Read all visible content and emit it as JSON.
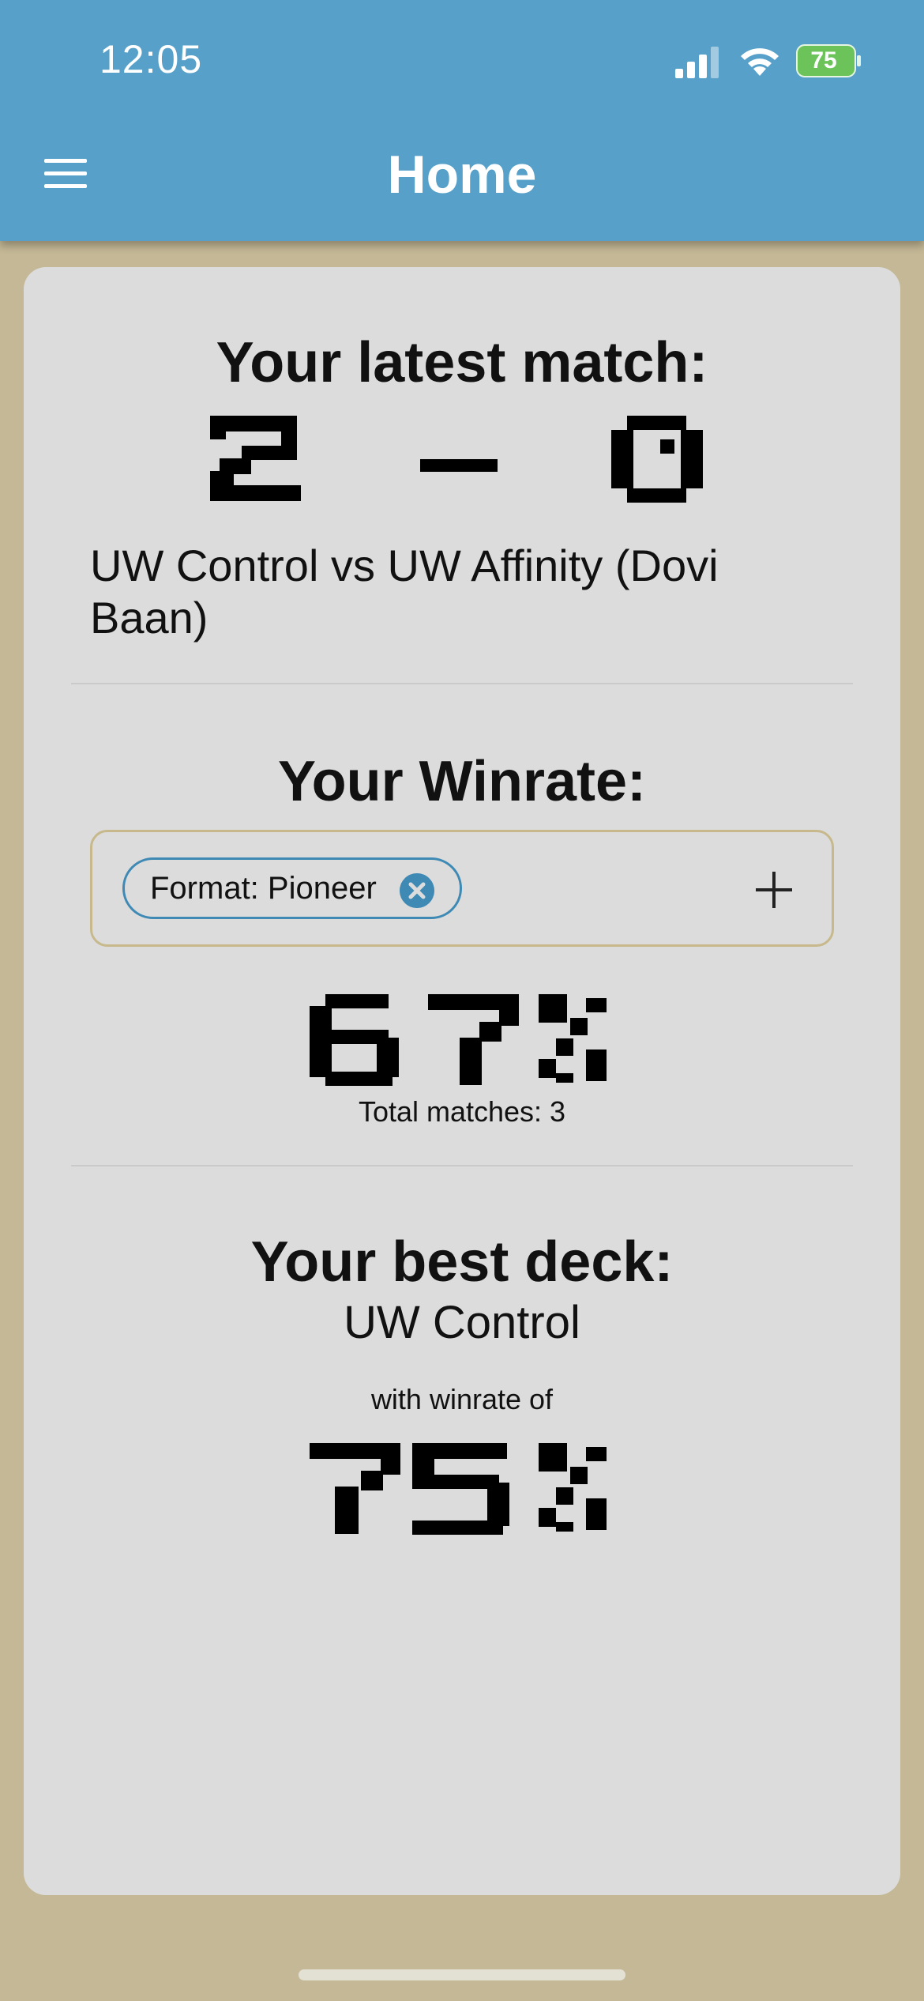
{
  "status_bar": {
    "time": "12:05",
    "battery_percent": "75",
    "icons": [
      "signal-icon",
      "wifi-icon",
      "battery-charging-icon"
    ]
  },
  "header": {
    "title": "Home",
    "menu_icon": "hamburger-menu-icon"
  },
  "latest_match": {
    "heading": "Your latest match:",
    "score_left": "2",
    "score_separator": "–",
    "score_right": "0",
    "description": "UW Control vs UW Affinity (Dovi Baan)"
  },
  "winrate": {
    "heading": "Your Winrate:",
    "filter_chip": "Format: Pioneer",
    "chip_close_icon": "close-circle-icon",
    "add_filter_icon": "plus-icon",
    "value": "67%",
    "total_matches": "Total matches: 3"
  },
  "best_deck": {
    "heading": "Your best deck:",
    "deck_name": "UW Control",
    "subtitle": "with winrate of",
    "value": "75%"
  },
  "colors": {
    "header_bg": "#56a0c9",
    "page_bg": "#c4b896",
    "card_bg": "#dcdcdc",
    "chip_accent": "#3e8ab5",
    "filter_border": "#c7b98c"
  }
}
